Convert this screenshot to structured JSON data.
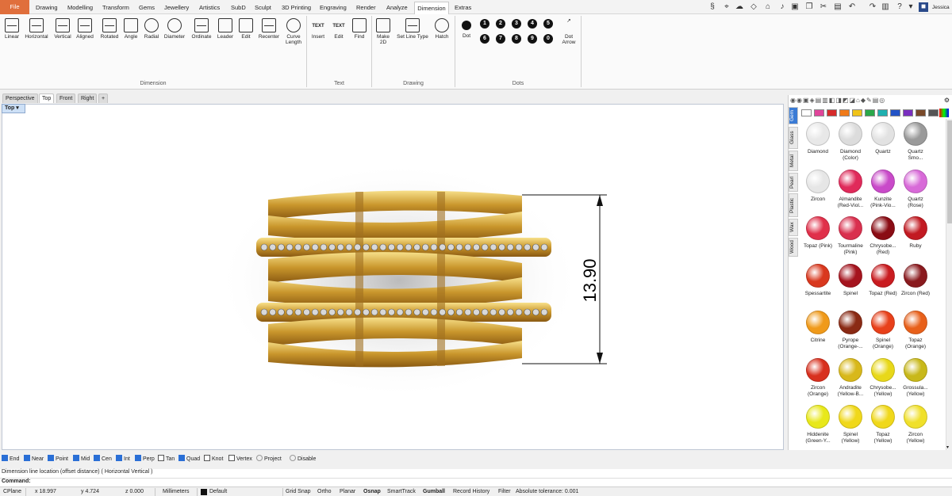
{
  "menu": {
    "file": "File",
    "tabs": [
      "Drawing",
      "Modelling",
      "Transform",
      "Gems",
      "Jewellery",
      "Artistics",
      "SubD",
      "Sculpt",
      "3D Printing",
      "Engraving",
      "Render",
      "Analyze",
      "Dimension",
      "Extras"
    ],
    "active_tab": "Dimension",
    "user": "Jessica"
  },
  "ribbon": {
    "dimension_buttons": [
      "Linear",
      "Horizontal",
      "Vertical",
      "Aligned",
      "Rotated",
      "Angle",
      "Radial",
      "Diameter",
      "Ordinate",
      "Leader",
      "Edit",
      "Recenter"
    ],
    "curve_length": [
      "Curve",
      "Length"
    ],
    "dimension_label": "Dimension",
    "text_buttons": [
      "Insert",
      "Edit",
      "Find"
    ],
    "text_icon_labels": [
      "TEXT",
      "TEXT"
    ],
    "text_label": "Text",
    "drawing_buttons": {
      "make2d": [
        "Make",
        "2D"
      ],
      "set_line_type": "Set Line Type",
      "hatch": "Hatch"
    },
    "drawing_label": "Drawing",
    "dots": {
      "dot_label": "Dot",
      "numbers": [
        "1",
        "2",
        "3",
        "4",
        "5",
        "6",
        "7",
        "8",
        "9",
        "0"
      ],
      "dot_arrow": [
        "Dot",
        "Arrow"
      ]
    },
    "dots_label": "Dots"
  },
  "viewport": {
    "tabs": [
      "Perspective",
      "Top",
      "Front",
      "Right"
    ],
    "add_tab": "+",
    "active_view": "Top",
    "dimension_value": "13.90"
  },
  "panel": {
    "side_tabs": [
      "Gem",
      "Glass",
      "Metal",
      "Pearl",
      "Plastic",
      "Wax",
      "Wood"
    ],
    "swatch_colors": [
      "#ffffff",
      "#e0459a",
      "#d62b2b",
      "#f07a19",
      "#f0c419",
      "#2aa84a",
      "#1fb0b0",
      "#2353c6",
      "#7a2fbf",
      "#7a4a2a",
      "#555555"
    ],
    "gems": [
      {
        "label": "Diamond",
        "color": "#e8e8e8"
      },
      {
        "label": "Diamond (Color)",
        "color": "#dcdcdc"
      },
      {
        "label": "Quartz",
        "color": "#e2e2e2"
      },
      {
        "label": "Quartz Smo...",
        "color": "#9a9a9a"
      },
      {
        "label": "Zircon",
        "color": "#e6e6e6"
      },
      {
        "label": "Almandite (Red-Viol...",
        "color": "#e02a5a"
      },
      {
        "label": "Kunzite (Pink-Vio...",
        "color": "#c94ac9"
      },
      {
        "label": "Quartz (Rose)",
        "color": "#d86ad8"
      },
      {
        "label": "Topaz (Pink)",
        "color": "#e0304a"
      },
      {
        "label": "Tourmaline (Pink)",
        "color": "#d9304e"
      },
      {
        "label": "Chrysobe... (Red)",
        "color": "#8a0c14"
      },
      {
        "label": "Ruby",
        "color": "#c21a22"
      },
      {
        "label": "Spessartite",
        "color": "#d9381e"
      },
      {
        "label": "Spinel",
        "color": "#a5141e"
      },
      {
        "label": "Topaz (Red)",
        "color": "#c91c20"
      },
      {
        "label": "Zircon (Red)",
        "color": "#8a1a1e"
      },
      {
        "label": "Citrine",
        "color": "#f09a1a"
      },
      {
        "label": "Pyrope (Orange-...",
        "color": "#8a2a14"
      },
      {
        "label": "Spinel (Orange)",
        "color": "#e8401a"
      },
      {
        "label": "Topaz (Orange)",
        "color": "#e8601a"
      },
      {
        "label": "Zircon (Orange)",
        "color": "#d8301e"
      },
      {
        "label": "Andradite (Yellow-B...",
        "color": "#d8b81a"
      },
      {
        "label": "Chrysobe... (Yellow)",
        "color": "#e8d81a"
      },
      {
        "label": "Grossula... (Yellow)",
        "color": "#c8b81a"
      },
      {
        "label": "Hiddenite (Green-Y...",
        "color": "#e8e81a"
      },
      {
        "label": "Spinel (Yellow)",
        "color": "#f0d81a"
      },
      {
        "label": "Topaz (Yellow)",
        "color": "#f0d81a"
      },
      {
        "label": "Zircon (Yellow)",
        "color": "#f0e02a"
      }
    ]
  },
  "osnap": {
    "items": [
      {
        "label": "End",
        "checked": true
      },
      {
        "label": "Near",
        "checked": true
      },
      {
        "label": "Point",
        "checked": true
      },
      {
        "label": "Mid",
        "checked": true
      },
      {
        "label": "Cen",
        "checked": true
      },
      {
        "label": "Int",
        "checked": true
      },
      {
        "label": "Perp",
        "checked": true
      },
      {
        "label": "Tan",
        "checked": false
      },
      {
        "label": "Quad",
        "checked": true
      },
      {
        "label": "Knot",
        "checked": false
      },
      {
        "label": "Vertex",
        "checked": false
      }
    ],
    "project": "Project",
    "disable": "Disable"
  },
  "command": {
    "history": "Dimension line location (offset distance) ( Horizontal  Vertical )",
    "prompt": "Command:"
  },
  "status": {
    "cplane": "CPlane",
    "x": "x 18.997",
    "y": "y 4.724",
    "z": "z 0.000",
    "units": "Millimeters",
    "layer": "Default",
    "grid_snap": "Grid Snap",
    "ortho": "Ortho",
    "planar": "Planar",
    "osnap": "Osnap",
    "smarttrack": "SmartTrack",
    "gumball": "Gumball",
    "record_history": "Record History",
    "filter": "Filter",
    "tolerance": "Absolute tolerance: 0.001"
  }
}
